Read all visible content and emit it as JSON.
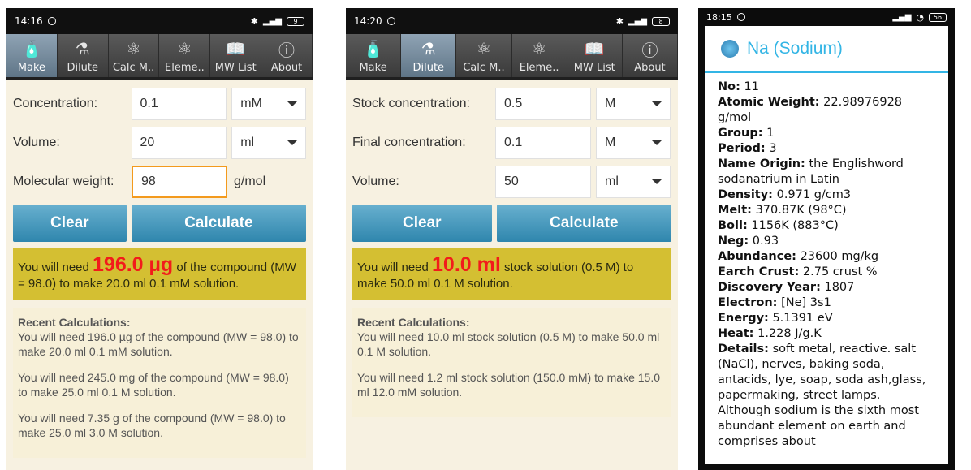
{
  "screen1": {
    "time": "14:16",
    "battery": "9",
    "tabs": [
      "Make",
      "Dilute",
      "Calc M..",
      "Eleme..",
      "MW List",
      "About"
    ],
    "concentration_label": "Concentration:",
    "concentration_value": "0.1",
    "concentration_unit": "mM",
    "volume_label": "Volume:",
    "volume_value": "20",
    "volume_unit": "ml",
    "mw_label": "Molecular weight:",
    "mw_value": "98",
    "mw_unit": "g/mol",
    "clear_label": "Clear",
    "calculate_label": "Calculate",
    "result_prefix": "You will need ",
    "result_amount": "196.0 µg",
    "result_suffix": " of the compound (MW = 98.0) to make 20.0 ml 0.1 mM solution.",
    "recent_heading": "Recent Calculations:",
    "recent": [
      "You will need 196.0 µg of the compound (MW = 98.0) to make 20.0 ml 0.1 mM solution.",
      "You will need 245.0 mg of the compound (MW = 98.0) to make 25.0 ml 0.1 M solution.",
      "You will need 7.35 g of the compound (MW = 98.0) to make 25.0 ml 3.0 M solution."
    ]
  },
  "screen2": {
    "time": "14:20",
    "battery": "8",
    "tabs": [
      "Make",
      "Dilute",
      "Calc M..",
      "Eleme..",
      "MW List",
      "About"
    ],
    "stock_label": "Stock concentration:",
    "stock_value": "0.5",
    "stock_unit": "M",
    "final_label": "Final concentration:",
    "final_value": "0.1",
    "final_unit": "M",
    "volume_label": "Volume:",
    "volume_value": "50",
    "volume_unit": "ml",
    "clear_label": "Clear",
    "calculate_label": "Calculate",
    "result_prefix": "You will need ",
    "result_amount": "10.0 ml",
    "result_suffix": " stock solution (0.5 M) to make 50.0 ml 0.1 M solution.",
    "recent_heading": "Recent Calculations:",
    "recent": [
      "You will need 10.0 ml stock solution (0.5 M) to make 50.0 ml 0.1 M solution.",
      "You will need 1.2 ml stock solution (150.0 mM) to make 15.0 ml 12.0 mM solution."
    ]
  },
  "screen3": {
    "time": "18:15",
    "battery": "56",
    "dialog_title": "Na (Sodium)",
    "fields": [
      {
        "k": "No:",
        "v": " 11"
      },
      {
        "k": "Atomic Weight:",
        "v": " 22.98976928 g/mol"
      },
      {
        "k": "Group:",
        "v": " 1"
      },
      {
        "k": "Period:",
        "v": " 3"
      },
      {
        "k": "Name Origin:",
        "v": " the Englishword sodanatrium in Latin"
      },
      {
        "k": "Density:",
        "v": " 0.971 g/cm3"
      },
      {
        "k": "Melt:",
        "v": " 370.87K (98°C)"
      },
      {
        "k": "Boil:",
        "v": " 1156K (883°C)"
      },
      {
        "k": "Neg:",
        "v": " 0.93"
      },
      {
        "k": "Abundance:",
        "v": " 23600 mg/kg"
      },
      {
        "k": "Earch Crust:",
        "v": " 2.75 crust %"
      },
      {
        "k": "Discovery Year:",
        "v": " 1807"
      },
      {
        "k": "Electron:",
        "v": " [Ne] 3s1"
      },
      {
        "k": "Energy:",
        "v": " 5.1391 eV"
      },
      {
        "k": "Heat:",
        "v": " 1.228 J/g.K"
      },
      {
        "k": "Details:",
        "v": " soft metal, reactive. salt (NaCl), nerves, baking soda, antacids, lye, soap, soda ash,glass, papermaking, street lamps. Although sodium is the sixth most abundant element on earth and comprises about"
      }
    ]
  }
}
